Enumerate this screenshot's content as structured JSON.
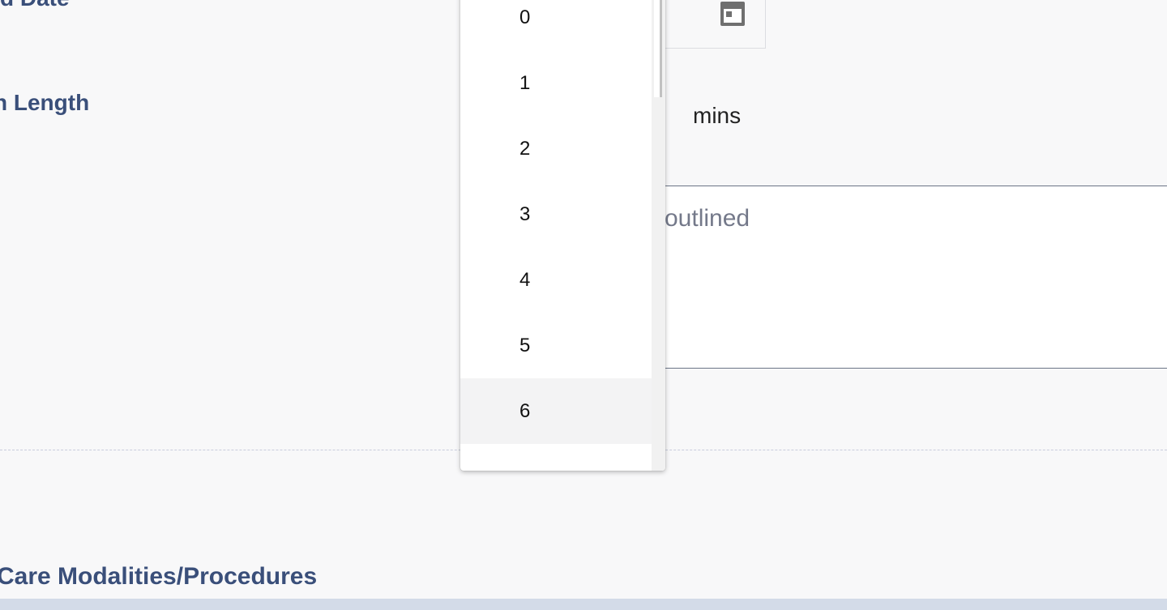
{
  "form": {
    "date_label": "d Date",
    "length_label": "n Length",
    "length_unit": "mins",
    "notes_placeholder": "outlined",
    "section_title": "Care Modalities/Procedures"
  },
  "dropdown": {
    "options": [
      "0",
      "1",
      "2",
      "3",
      "4",
      "5",
      "6"
    ],
    "highlighted": "6"
  },
  "icons": {
    "date_picker": "calendar-icon"
  },
  "colors": {
    "label": "#3a4f7a",
    "background": "#f8f8f9",
    "highlight": "#f3f3f4",
    "bottom_strip": "#d3dbe8"
  }
}
